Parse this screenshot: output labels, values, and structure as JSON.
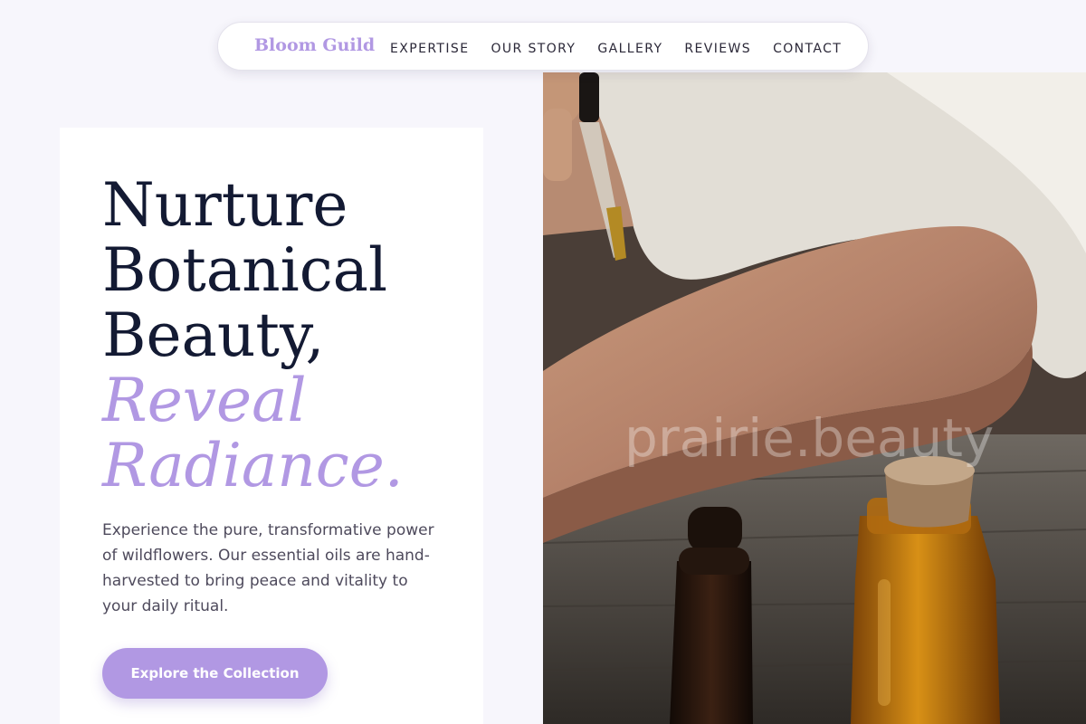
{
  "brand": {
    "name": "Bloom Guild"
  },
  "nav": {
    "links": [
      {
        "label": "EXPERTISE"
      },
      {
        "label": "OUR STORY"
      },
      {
        "label": "GALLERY"
      },
      {
        "label": "REVIEWS"
      },
      {
        "label": "CONTACT"
      }
    ]
  },
  "hero": {
    "headline_line1": "Nurture",
    "headline_line2": "Botanical",
    "headline_line3": "Beauty,",
    "headline_accent_line1": "Reveal",
    "headline_accent_line2": "Radiance.",
    "description": "Experience the pure, transformative power of wildflowers. Our essential oils are hand-harvested to bring peace and vitality to your daily ritual.",
    "cta_label": "Explore the Collection",
    "image_alt": "Hand applying essential oil from a dropper onto a forearm beside small bottles on a wooden table"
  },
  "watermark": "prairie.beauty",
  "colors": {
    "accent": "#b198e3",
    "heading": "#131a33",
    "body_text": "#4e4a5c",
    "page_background": "#f7f6fc"
  }
}
